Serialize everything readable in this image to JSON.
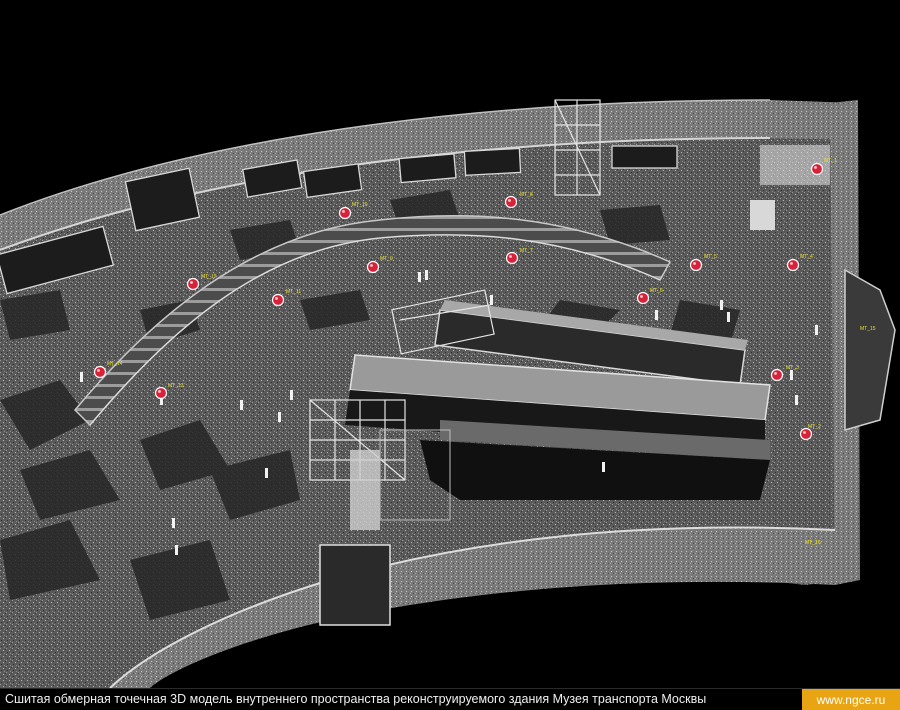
{
  "caption": "Сшитая обмерная точечная 3D модель внутреннего пространства реконструируемого здания Музея транспорта Москвы",
  "site": "www.ngce.ru",
  "colors": {
    "marker": "#d8223a",
    "label": "#e8e020",
    "banner": "#e8a413"
  },
  "markers": [
    {
      "label": "MT_1"
    },
    {
      "label": "MT_2"
    },
    {
      "label": "MT_3"
    },
    {
      "label": "MT_4"
    },
    {
      "label": "MT_5"
    },
    {
      "label": "MT_6"
    },
    {
      "label": "MT_7"
    },
    {
      "label": "MT_8"
    },
    {
      "label": "MT_9"
    },
    {
      "label": "MT_10"
    },
    {
      "label": "MT_11"
    },
    {
      "label": "MT_12"
    },
    {
      "label": "MT_13"
    },
    {
      "label": "MT_14"
    },
    {
      "label": "MT_15"
    },
    {
      "label": "MT_16"
    }
  ]
}
